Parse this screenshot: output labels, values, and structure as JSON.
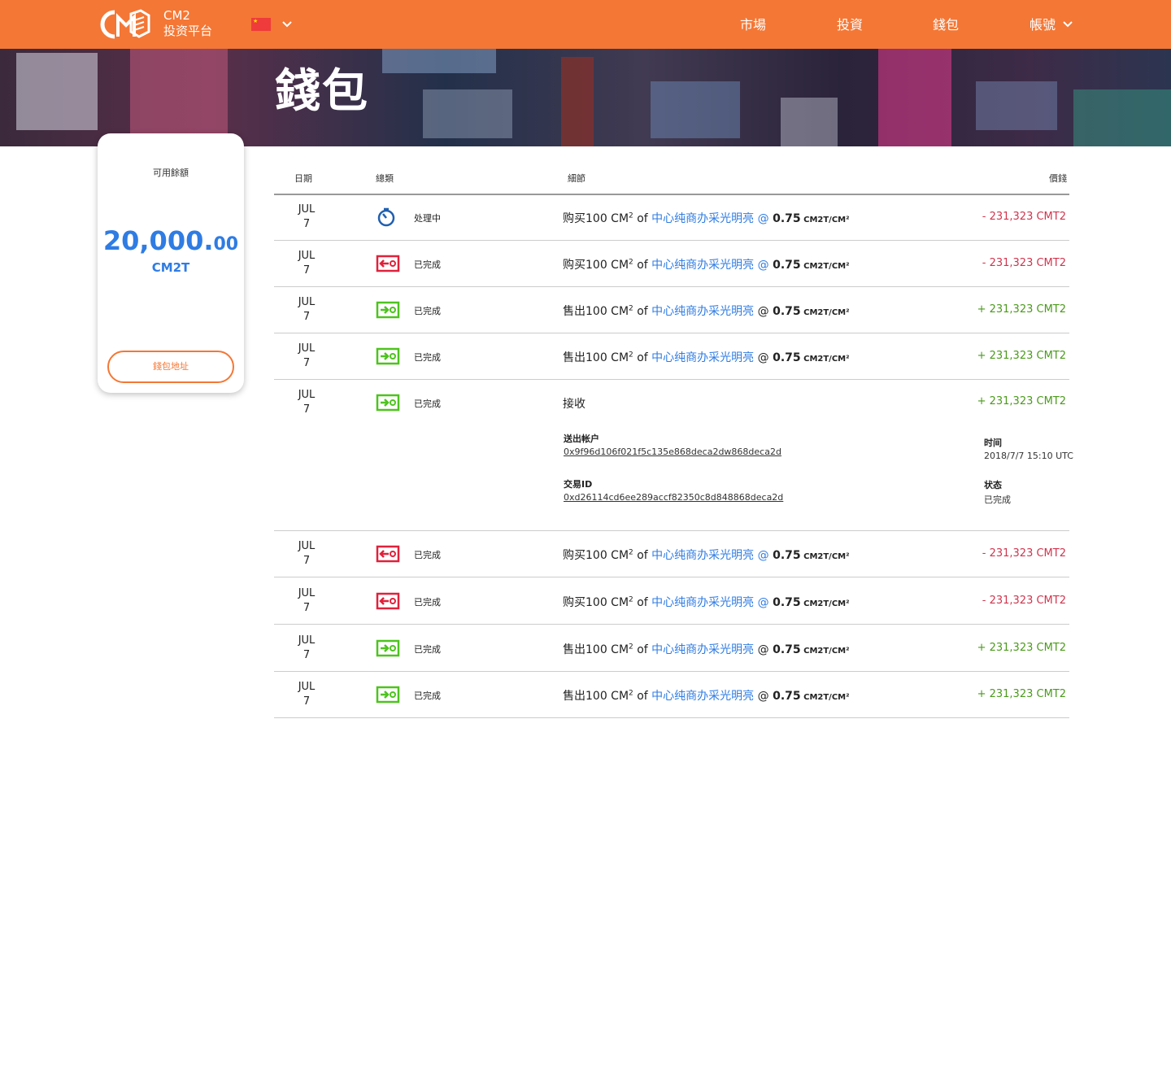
{
  "header": {
    "brand_line1": "CM2",
    "brand_line2": "投资平台",
    "nav": [
      "市場",
      "投資",
      "錢包",
      "帳號"
    ],
    "accent_color": "#f47735"
  },
  "hero": {
    "title": "錢包"
  },
  "balance_card": {
    "label": "可用餘額",
    "amount_int": "20,000.",
    "amount_dec": "00",
    "unit": "CM2T",
    "address_button": "錢包地址"
  },
  "table": {
    "headers": {
      "date": "日期",
      "type": "總類",
      "detail": "細節",
      "amount": "價錢"
    },
    "rows": [
      {
        "month": "JUL",
        "day": "7",
        "icon": "timer-icon",
        "status": "处理中",
        "action": "购买100 CM",
        "sup": "2",
        "of": " of ",
        "property": "中心纯商办采光明亮",
        "at": " @ ",
        "at_blue": true,
        "price": "0.75",
        "unit": " CM2T/CM²",
        "amount": "- 231,323 CMT2",
        "sign": "neg"
      },
      {
        "month": "JUL",
        "day": "7",
        "icon": "transfer-out-icon",
        "status": "已完成",
        "action": "购买100 CM",
        "sup": "2",
        "of": " of ",
        "property": "中心纯商办采光明亮",
        "at": " @ ",
        "at_blue": true,
        "price": "0.75",
        "unit": " CM2T/CM²",
        "amount": "- 231,323 CMT2",
        "sign": "neg"
      },
      {
        "month": "JUL",
        "day": "7",
        "icon": "transfer-in-icon",
        "status": "已完成",
        "action": "售出100 CM",
        "sup": "2",
        "of": " of ",
        "property": "中心纯商办采光明亮",
        "at": " @ ",
        "at_blue": false,
        "price": "0.75",
        "unit": " CM2T/CM²",
        "amount": "+ 231,323 CMT2",
        "sign": "pos"
      },
      {
        "month": "JUL",
        "day": "7",
        "icon": "transfer-in-icon",
        "status": "已完成",
        "action": "售出100 CM",
        "sup": "2",
        "of": " of ",
        "property": "中心纯商办采光明亮",
        "at": " @ ",
        "at_blue": false,
        "price": "0.75",
        "unit": " CM2T/CM²",
        "amount": "+ 231,323 CMT2",
        "sign": "pos"
      }
    ],
    "expanded_row": {
      "month": "JUL",
      "day": "7",
      "icon": "transfer-in-icon",
      "status": "已完成",
      "title": "接收",
      "amount": "+ 231,323 CMT2",
      "sender_label": "送出帐户",
      "sender_value": "0x9f96d106f021f5c135e868deca2dw868deca2d",
      "txid_label": "交易ID",
      "txid_value": "0xd26114cd6ee289accf82350c8d848868deca2d",
      "time_label": "时间",
      "time_value": "2018/7/7 15:10 UTC",
      "state_label": "状态",
      "state_value": "已完成"
    },
    "rows_after": [
      {
        "month": "JUL",
        "day": "7",
        "icon": "transfer-out-icon",
        "status": "已完成",
        "action": "购买100 CM",
        "sup": "2",
        "of": " of ",
        "property": "中心纯商办采光明亮",
        "at": " @ ",
        "at_blue": true,
        "price": "0.75",
        "unit": " CM2T/CM²",
        "amount": "- 231,323 CMT2",
        "sign": "neg"
      },
      {
        "month": "JUL",
        "day": "7",
        "icon": "transfer-out-icon",
        "status": "已完成",
        "action": "购买100 CM",
        "sup": "2",
        "of": " of ",
        "property": "中心纯商办采光明亮",
        "at": " @ ",
        "at_blue": true,
        "price": "0.75",
        "unit": " CM2T/CM²",
        "amount": "- 231,323 CMT2",
        "sign": "neg"
      },
      {
        "month": "JUL",
        "day": "7",
        "icon": "transfer-in-icon",
        "status": "已完成",
        "action": "售出100 CM",
        "sup": "2",
        "of": " of ",
        "property": "中心纯商办采光明亮",
        "at": " @ ",
        "at_blue": false,
        "price": "0.75",
        "unit": " CM2T/CM²",
        "amount": "+ 231,323 CMT2",
        "sign": "pos"
      },
      {
        "month": "JUL",
        "day": "7",
        "icon": "transfer-in-icon",
        "status": "已完成",
        "action": "售出100 CM",
        "sup": "2",
        "of": " of ",
        "property": "中心纯商办采光明亮",
        "at": " @ ",
        "at_blue": false,
        "price": "0.75",
        "unit": " CM2T/CM²",
        "amount": "+ 231,323 CMT2",
        "sign": "pos"
      }
    ]
  }
}
